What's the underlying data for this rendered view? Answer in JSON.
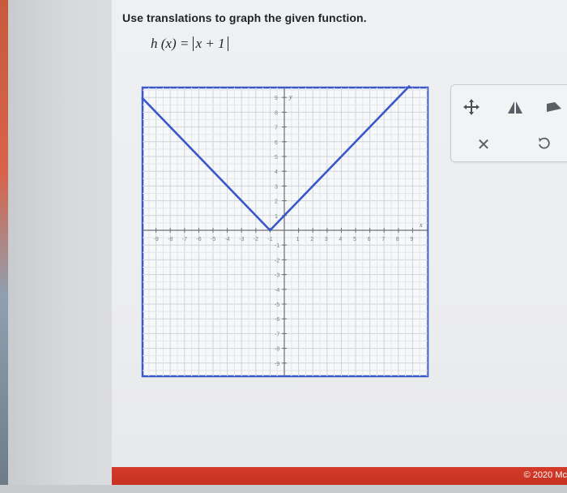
{
  "question": "Use translations to graph the given function.",
  "function": {
    "lhs": "h (x) = ",
    "abs_content": "x + 1"
  },
  "graph": {
    "x_axis_label": "x",
    "y_axis_label": "y",
    "x_tick_labels": [
      "-9",
      "-8",
      "-7",
      "-6",
      "-5",
      "-4",
      "-3",
      "-2",
      "-1",
      "1",
      "2",
      "3",
      "4",
      "5",
      "6",
      "7",
      "8",
      "9"
    ],
    "y_tick_labels": [
      "9",
      "8",
      "7",
      "6",
      "5",
      "4",
      "3",
      "2",
      "1",
      "-1",
      "-2",
      "-3",
      "-4",
      "-5",
      "-6",
      "-7",
      "-8",
      "-9"
    ],
    "plot_color": "#3a57c9",
    "line_points": [
      [
        -10,
        9
      ],
      [
        -1,
        0
      ],
      [
        8.8,
        9.8
      ]
    ]
  },
  "toolbox": {
    "move_icon": "move-arrows-icon",
    "tool2_icon": "shape-tool-icon",
    "tool3_icon": "partial-tool-icon",
    "clear_icon": "close-icon",
    "undo_icon": "undo-icon"
  },
  "footer": {
    "copyright": "© 2020 Mc",
    "color": "#d33a2a"
  }
}
